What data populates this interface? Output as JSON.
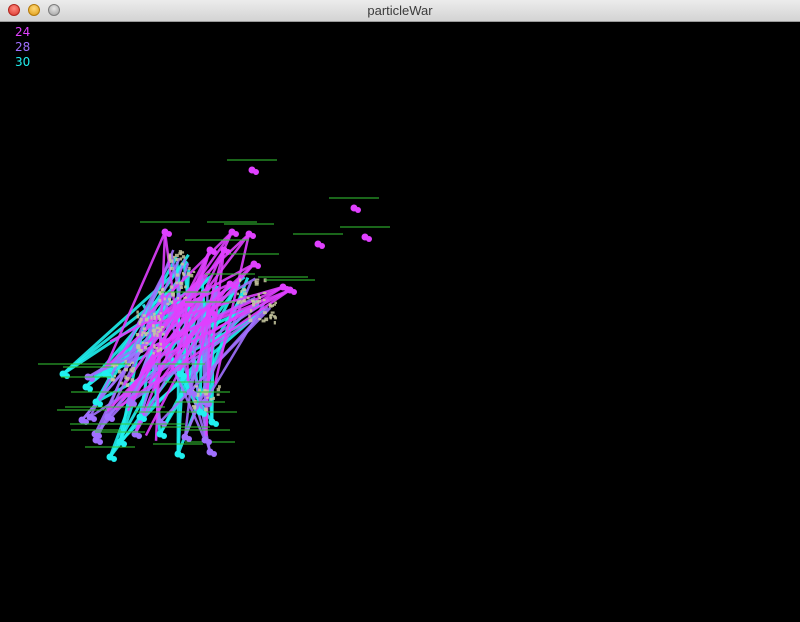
{
  "window": {
    "title": "particleWar"
  },
  "colors": {
    "team_magenta": "#e040ff",
    "team_purple": "#a070ff",
    "team_cyan": "#20f0f0",
    "health_bar": "#33cc33",
    "explosion": "#c8c8a0"
  },
  "counters": [
    {
      "value": "24",
      "color": "#e040ff"
    },
    {
      "value": "28",
      "color": "#a070ff"
    },
    {
      "value": "30",
      "color": "#20f0f0"
    }
  ]
}
